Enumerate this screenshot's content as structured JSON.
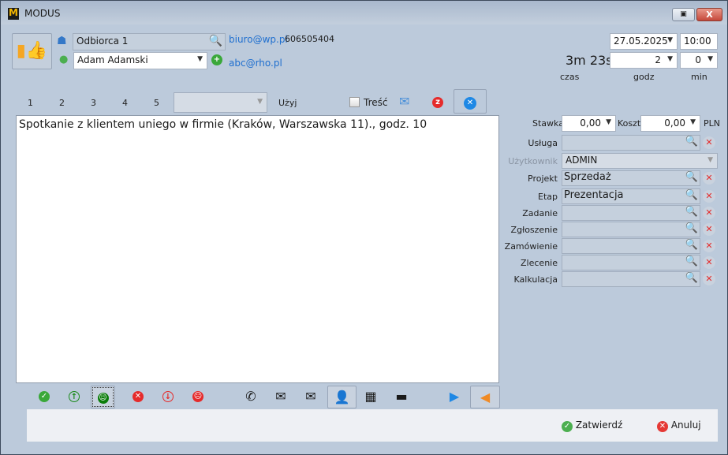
{
  "window": {
    "title": "MODUS",
    "logo_letter": "M"
  },
  "header": {
    "recipient": "Odbiorca 1",
    "contact": "Adam Adamski",
    "recipient_email": "biuro@wp.pl",
    "recipient_phone": "606505404",
    "contact_email": "abc@rho.pl",
    "date": "27.05.2025",
    "time": "10:00",
    "duration": "3m 23s",
    "hours": "2",
    "minutes": "0",
    "duration_label": "czas",
    "hours_label": "godz",
    "minutes_label": "min"
  },
  "templates": {
    "tabs": [
      "1",
      "2",
      "3",
      "4",
      "5"
    ],
    "select_value": "",
    "use_label": "Użyj",
    "content_checkbox_label": "Treść",
    "content_checked": false
  },
  "note": "Spotkanie z klientem uniego w firmie (Kraków, Warszawska 11)., godz. 10",
  "right": {
    "rate_label": "Stawka",
    "rate": "0,00",
    "cost_label": "Koszt",
    "cost": "0,00",
    "currency": "PLN",
    "fields": [
      {
        "label": "Usługa",
        "value": ""
      },
      {
        "label": "Użytkownik",
        "value": "ADMIN",
        "disabled": true
      },
      {
        "label": "Projekt",
        "value": "Sprzedaż"
      },
      {
        "label": "Etap",
        "value": "Prezentacja"
      },
      {
        "label": "Zadanie",
        "value": ""
      },
      {
        "label": "Zgłoszenie",
        "value": ""
      },
      {
        "label": "Zamówienie",
        "value": ""
      },
      {
        "label": "Zlecenie",
        "value": ""
      },
      {
        "label": "Kalkulacja",
        "value": ""
      }
    ]
  },
  "footer": {
    "confirm": "Zatwierdź",
    "cancel": "Anuluj"
  },
  "colors": {
    "background": "#bccadb",
    "link": "#1f6fcf",
    "green": "#3aa83a",
    "red": "#e52b2b",
    "blue": "#1e88e5",
    "orange": "#f08a24"
  }
}
